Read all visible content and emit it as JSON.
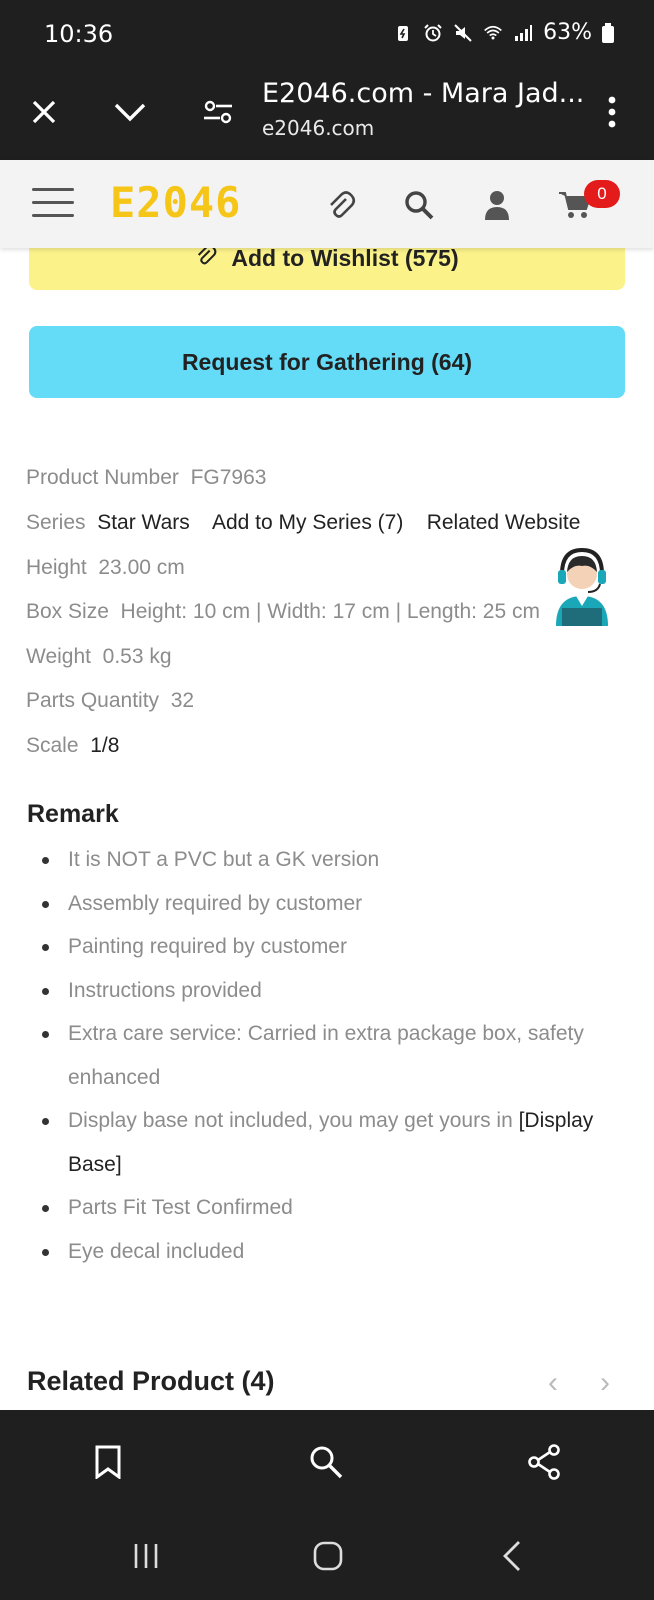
{
  "status": {
    "time": "10:36",
    "battery": "63%",
    "icons": [
      "battery-saver-icon",
      "alarm-icon",
      "mute-icon",
      "wifi-icon",
      "signal-icon",
      "battery-icon"
    ]
  },
  "browser": {
    "title": "E2046.com - Mara Jad...",
    "domain": "e2046.com",
    "icons": [
      "close-icon",
      "chevron-down-icon",
      "site-settings-icon",
      "more-vertical-icon"
    ]
  },
  "header": {
    "logo": "E2046",
    "cart_count": "0",
    "icons": [
      "menu-icon",
      "paperclip-icon",
      "search-icon",
      "user-icon",
      "cart-icon"
    ]
  },
  "actions": {
    "wishlist_label": "Add to Wishlist (575)",
    "gathering_label": "Request for Gathering (64)"
  },
  "specs": {
    "product_number_label": "Product Number",
    "product_number": "FG7963",
    "series_label": "Series",
    "series_value": "Star Wars",
    "add_series": "Add to My Series (7)",
    "related_website": "Related Website",
    "height_label": "Height",
    "height_value": "23.00 cm",
    "box_size_label": "Box Size",
    "box_size_value": "Height: 10 cm | Width: 17 cm | Length: 25 cm",
    "weight_label": "Weight",
    "weight_value": "0.53 kg",
    "parts_label": "Parts Quantity",
    "parts_value": "32",
    "scale_label": "Scale",
    "scale_value": "1/8"
  },
  "remark": {
    "title": "Remark",
    "items": [
      "It is NOT a PVC but a GK version",
      "Assembly required by customer",
      "Painting required by customer",
      "Instructions provided",
      "Extra care service: Carried in extra package box, safety enhanced",
      "Display base not included, you may get yours in",
      "Parts Fit Test Confirmed",
      "Eye decal included"
    ],
    "display_base_link": "[Display Base]"
  },
  "related": {
    "title": "Related Product (4)",
    "prev": "‹",
    "next": "›"
  },
  "bottom_nav": {
    "icons": [
      "bookmark-icon",
      "search-icon",
      "share-icon",
      "recent-apps-icon",
      "home-icon",
      "back-icon"
    ]
  }
}
